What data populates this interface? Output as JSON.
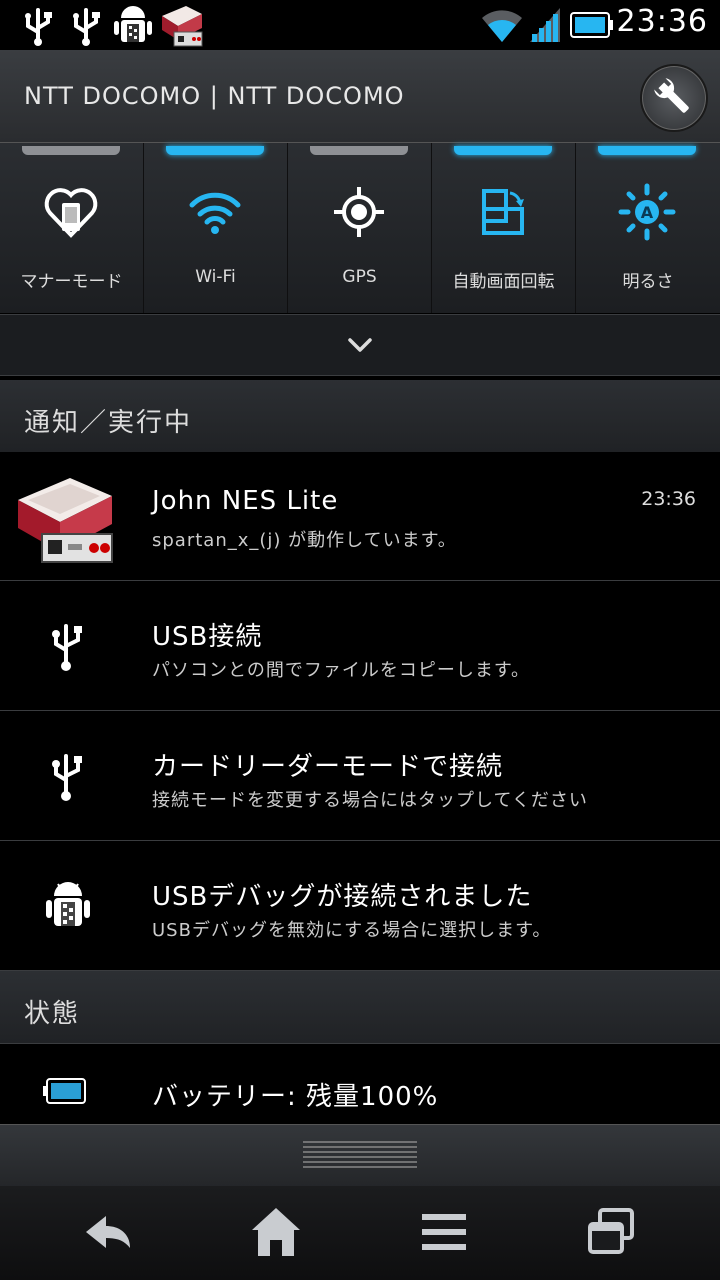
{
  "status_bar": {
    "time": "23:36",
    "notification_icons": [
      "usb-icon",
      "usb-icon",
      "android-debug-icon",
      "famicom-icon"
    ],
    "system_icons": [
      "wifi-icon",
      "signal-icon",
      "battery-icon"
    ]
  },
  "header": {
    "carrier": "NTT DOCOMO | NTT DOCOMO",
    "settings_icon": "wrench-icon"
  },
  "toggles": [
    {
      "label": "マナーモード",
      "icon": "manner-mode-icon",
      "active": false
    },
    {
      "label": "Wi-Fi",
      "icon": "wifi-icon",
      "active": true
    },
    {
      "label": "GPS",
      "icon": "gps-icon",
      "active": false
    },
    {
      "label": "自動画面回転",
      "icon": "auto-rotate-icon",
      "active": true
    },
    {
      "label": "明るさ",
      "icon": "brightness-icon",
      "active": true
    }
  ],
  "ongoing": {
    "title": "通知／実行中",
    "items": [
      {
        "title": "John NES Lite",
        "text": "spartan_x_(j) が動作しています。",
        "time": "23:36",
        "icon": "famicom-icon"
      },
      {
        "title": "USB接続",
        "text": "パソコンとの間でファイルをコピーします。",
        "icon": "usb-icon"
      },
      {
        "title": "カードリーダーモードで接続",
        "text": "接続モードを変更する場合にはタップしてください",
        "icon": "usb-icon"
      },
      {
        "title": "USBデバッグが接続されました",
        "text": "USBデバッグを無効にする場合に選択します。",
        "icon": "android-debug-icon"
      }
    ]
  },
  "status_section": {
    "title": "状態",
    "battery_text": "バッテリー: 残量100%"
  },
  "colors": {
    "accent": "#27b6f1",
    "background": "#000000"
  },
  "nav": [
    "back-icon",
    "home-icon",
    "menu-icon",
    "recent-apps-icon"
  ]
}
